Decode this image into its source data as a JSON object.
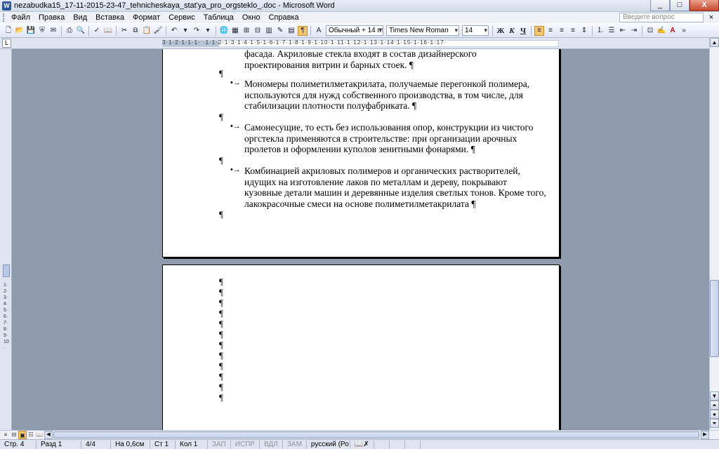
{
  "window": {
    "title": "nezabudka15_17-11-2015-23-47_tehnicheskaya_stat'ya_pro_orgsteklo_.doc - Microsoft Word",
    "minimize": "_",
    "maximize": "□",
    "close": "X"
  },
  "menu": {
    "items": [
      "Файл",
      "Правка",
      "Вид",
      "Вставка",
      "Формат",
      "Сервис",
      "Таблица",
      "Окно",
      "Справка"
    ],
    "help_placeholder": "Введите вопрос",
    "doc_close": "×"
  },
  "toolbar": {
    "style_value": "Обычный + 14 пт",
    "font_value": "Times New Roman",
    "size_value": "14",
    "bold": "Ж",
    "italic": "К",
    "underline": "Ч",
    "pilcrow": "¶"
  },
  "ruler": {
    "tab_selector": "L",
    "numbers": "3·1·2·1·1·1·  ·1·1·2·1·3·1·4·1·5·1·6·1·7·1·8·1·9·1·10·1·11·1·12·1·13·1·14·1·15·1·16·1·17·",
    "vnumbers": "1·2·3·4·5·6·7·8·9·10·"
  },
  "document": {
    "page1": {
      "top_fragment": "фасада. Акриловые стекла входят в состав дизайнерского\nпроектирования витрин и барных стоек. ¶",
      "empty_marks": [
        "¶",
        "¶",
        "¶",
        "¶"
      ],
      "bullet_char": "•→",
      "bullets": [
        "Мономеры полиметилметакрилата, получаемые перегонкой полимера, используются для нужд собственного производства, в том числе, для стабилизации плотности полуфабриката. ¶",
        "Самонесущие, то есть без использования опор, конструкции из чистого оргстекла применяются в строительстве: при организации арочных пролетов и оформлении куполов зенитными фонарями. ¶",
        "Комбинацией акриловых полимеров и органических растворителей, идущих на изготовление лаков по металлам и дереву, покрывают кузовные детали машин и деревянные изделия светлых тонов. Кроме того, лакокрасочные смеси на основе полиметилметакрилата ¶"
      ]
    },
    "page2": {
      "marks": [
        "¶",
        "¶",
        "¶",
        "¶",
        "¶",
        "¶",
        "¶",
        "¶",
        "¶",
        "¶",
        "¶",
        "¶"
      ]
    }
  },
  "statusbar": {
    "page": "Стр. 4",
    "section": "Разд 1",
    "pages": "4/4",
    "at": "На 0,6см",
    "line": "Ст 1",
    "col": "Кол 1",
    "rec": "ЗАП",
    "trk": "ИСПР",
    "ext": "ВДЛ",
    "ovr": "ЗАМ",
    "language": "русский (Ро"
  },
  "colors": {
    "workspace": "#8e9aad",
    "chrome": "#dfe5f0",
    "active_button": "#f8c870"
  }
}
